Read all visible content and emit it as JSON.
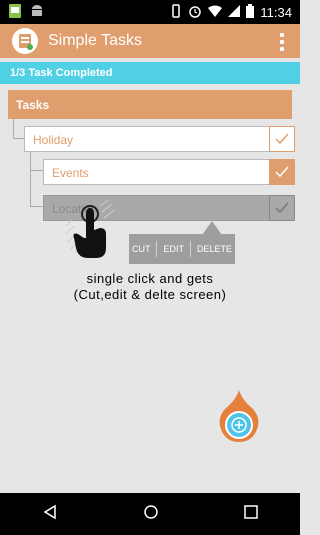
{
  "status_bar": {
    "time": "11:34",
    "icons": [
      "gallery-icon",
      "android-icon",
      "vibrate-icon",
      "alarm-icon",
      "wifi-icon",
      "signal-icon",
      "battery-icon"
    ]
  },
  "app_bar": {
    "title": "Simple Tasks",
    "logo_icon": "app-logo-icon",
    "menu_icon": "overflow-menu-icon"
  },
  "progress": {
    "label": "1/3 Task Completed",
    "completed": 1,
    "total": 3
  },
  "tasks": {
    "header": "Tasks",
    "items": [
      {
        "label": "Holiday",
        "checked": false
      },
      {
        "label": "Events",
        "checked": true
      },
      {
        "label": "Location",
        "checked": false,
        "highlighted": true
      }
    ]
  },
  "context_menu": {
    "items": [
      "CUT",
      "EDIT",
      "DELETE"
    ]
  },
  "tutorial": {
    "caption_line1": "single click and gets",
    "caption_line2": "(Cut,edit & delte screen)",
    "hand_icon": "pointing-hand-icon"
  },
  "fab": {
    "icon": "plus-icon"
  },
  "nav_bar": {
    "icons": [
      "back-icon",
      "home-icon",
      "recents-icon"
    ]
  },
  "colors": {
    "accent": "#e09d6d",
    "progress": "#4fd0e4",
    "background": "#e6e6e6"
  }
}
